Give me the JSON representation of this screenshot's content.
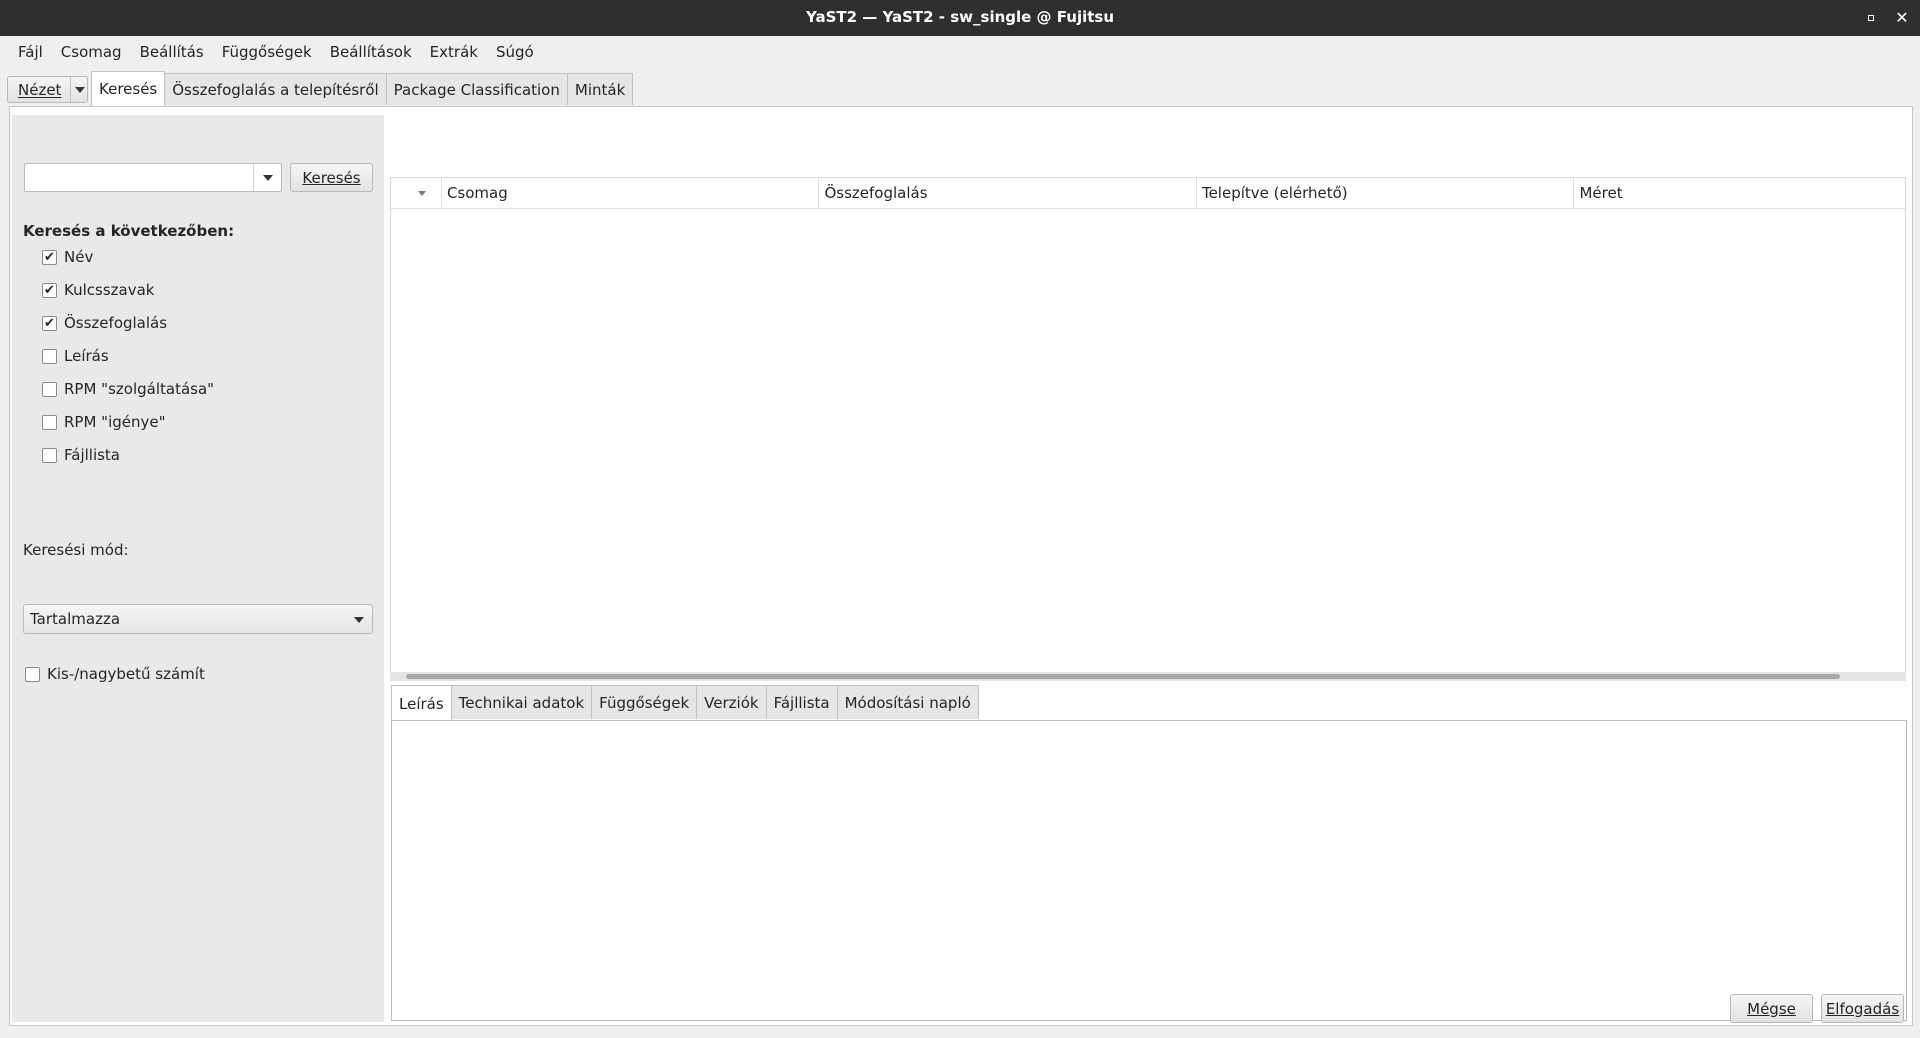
{
  "window": {
    "title": "YaST2 — YaST2 - sw_single @ Fujitsu"
  },
  "menubar": {
    "items": [
      {
        "label": "Fájl"
      },
      {
        "label": "Csomag"
      },
      {
        "label": "Beállítás"
      },
      {
        "label": "Függőségek"
      },
      {
        "label": "Beállítások"
      },
      {
        "label": "Extrák"
      },
      {
        "label": "Súgó"
      }
    ]
  },
  "view_button": {
    "label": "Nézet"
  },
  "top_tabs": [
    {
      "label": "Keresés",
      "active": true
    },
    {
      "label": "Összefoglalás a telepítésről"
    },
    {
      "label": "Package Classification"
    },
    {
      "label": "Minták"
    }
  ],
  "search": {
    "input_value": "",
    "button_label": "Keresés",
    "in_label": "Keresés a következőben:",
    "options": [
      {
        "label": "Név",
        "checked": true
      },
      {
        "label": "Kulcsszavak",
        "checked": true
      },
      {
        "label": "Összefoglalás",
        "checked": true
      },
      {
        "label": "Leírás",
        "checked": false
      },
      {
        "label": "RPM \"szolgáltatása\"",
        "checked": false
      },
      {
        "label": "RPM \"igénye\"",
        "checked": false
      },
      {
        "label": "Fájllista",
        "checked": false
      }
    ],
    "mode_label": "Keresési mód:",
    "mode_value": "Tartalmazza",
    "case_label": "Kis-/nagybetű számít",
    "case_checked": false
  },
  "table": {
    "columns": [
      "Csomag",
      "Összefoglalás",
      "Telepítve (elérhető)",
      "Méret"
    ],
    "rows": []
  },
  "detail_tabs": [
    {
      "label": "Leírás",
      "active": true
    },
    {
      "label": "Technikai adatok"
    },
    {
      "label": "Függőségek"
    },
    {
      "label": "Verziók"
    },
    {
      "label": "Fájllista"
    },
    {
      "label": "Módosítási napló"
    }
  ],
  "footer": {
    "cancel_label": "Mégse",
    "accept_label": "Elfogadás"
  },
  "icons": {
    "sort": "sort-down-icon",
    "dropdown": "chevron-down-icon",
    "close": "close-icon",
    "maximize": "maximize-icon"
  }
}
